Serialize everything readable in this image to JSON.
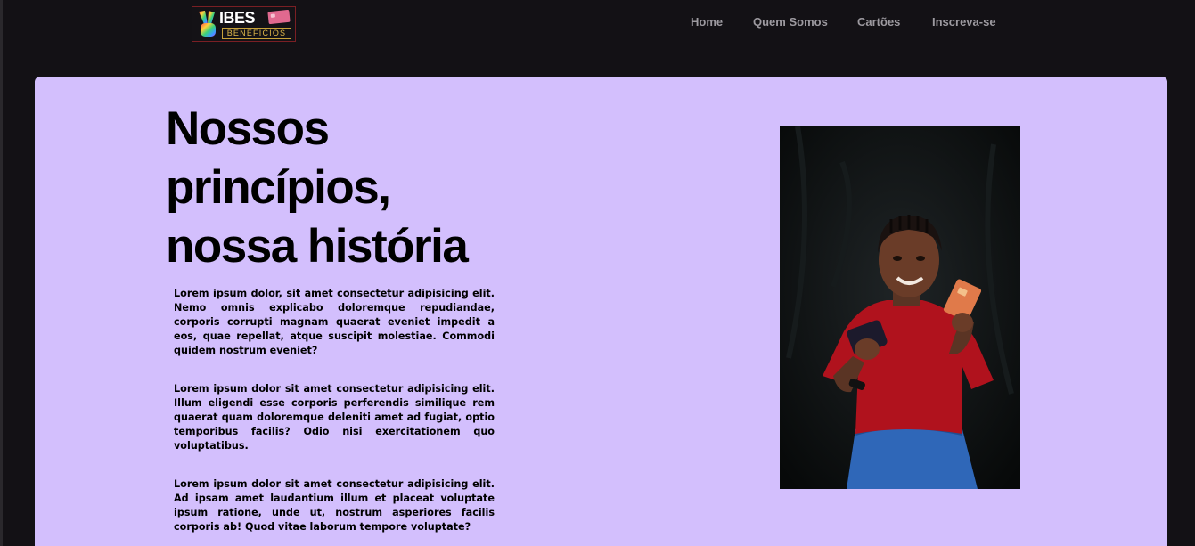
{
  "brand": {
    "logo_word": "IBES",
    "logo_sub": "BENEFÍCIOS"
  },
  "nav": {
    "items": [
      {
        "label": "Home"
      },
      {
        "label": "Quem Somos"
      },
      {
        "label": "Cartões"
      },
      {
        "label": "Inscreva-se"
      }
    ]
  },
  "hero": {
    "title_lines": [
      "Nossos",
      "princípios,",
      "nossa história"
    ],
    "paragraphs": [
      "Lorem ipsum dolor, sit amet consectetur adipisicing elit. Nemo omnis explicabo doloremque repudiandae, corporis corrupti magnam quaerat eveniet impedit a eos, quae repellat, atque suscipit molestiae. Commodi quidem nostrum eveniet?",
      "Lorem ipsum dolor sit amet consectetur adipisicing elit. Illum eligendi esse corporis perferendis similique rem quaerat quam doloremque deleniti amet ad fugiat, optio temporibus facilis? Odio nisi exercitationem quo voluptatibus.",
      "Lorem ipsum dolor sit amet consectetur adipisicing elit. Ad ipsam amet laudantium illum et placeat voluptate ipsum ratione, unde ut, nostrum asperiores facilis corporis ab! Quod vitae laborum tempore voluptate?"
    ]
  },
  "colors": {
    "page_background": "#131115",
    "hero_background": "#d3bffd",
    "nav_text": "#9d9aa0"
  }
}
